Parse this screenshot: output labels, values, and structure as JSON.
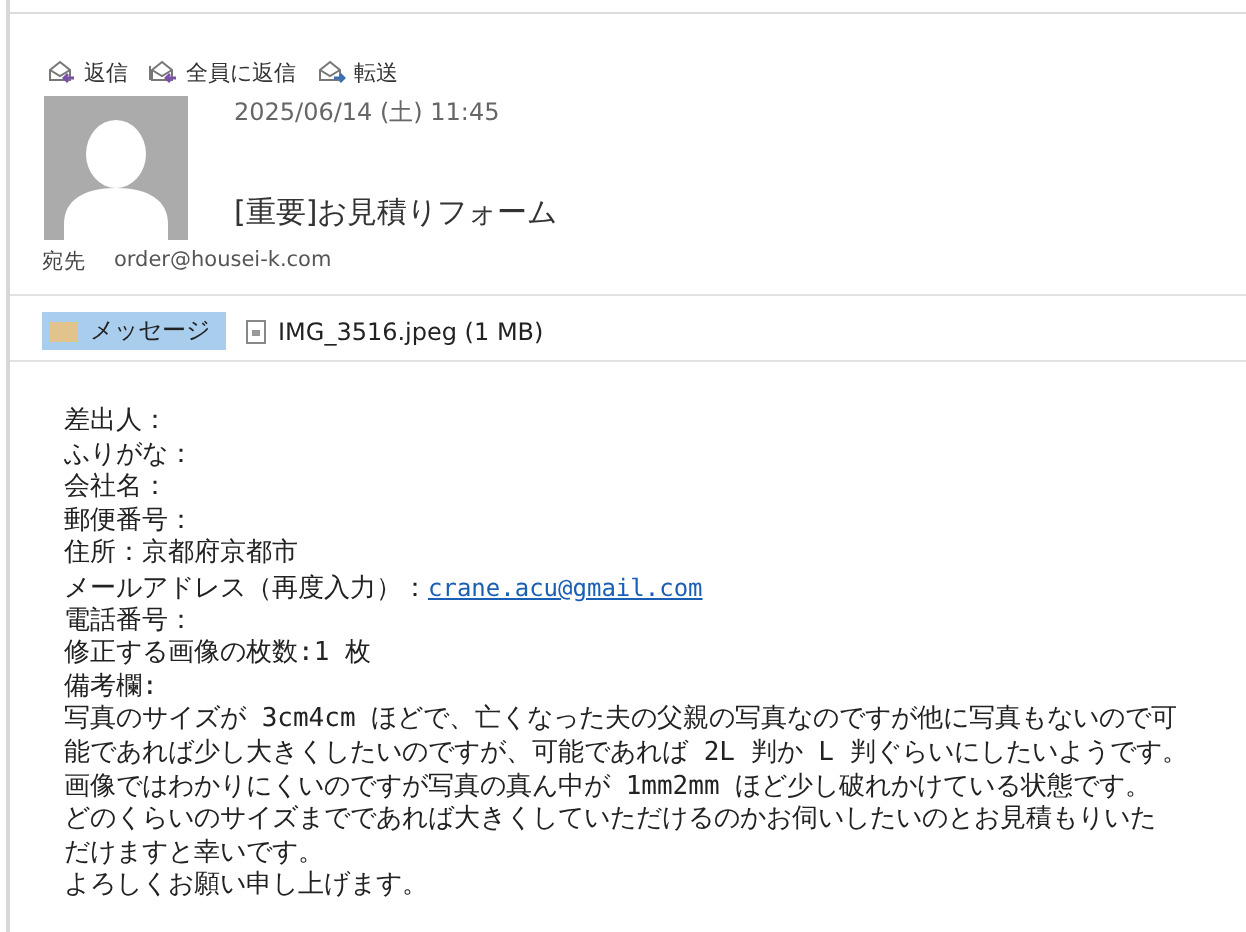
{
  "actions": [
    {
      "label": "返信",
      "kind": "reply"
    },
    {
      "label": "全員に返信",
      "kind": "reply_all"
    },
    {
      "label": "転送",
      "kind": "forward"
    }
  ],
  "date": "2025/06/14 (土) 11:45",
  "subject": "[重要]お見積りフォーム",
  "to": {
    "label": "宛先",
    "address": "order@housei-k.com"
  },
  "attachments": [
    {
      "label": "メッセージ",
      "kind": "message",
      "selected": true
    },
    {
      "label": "IMG_3516.jpeg (1 MB)",
      "kind": "file",
      "selected": false
    }
  ],
  "body": [
    {
      "text": "差出人："
    },
    {
      "text": "ふりがな："
    },
    {
      "text": "会社名："
    },
    {
      "text": "郵便番号："
    },
    {
      "text": "住所：京都府京都市"
    },
    {
      "text": "メールアドレス（再度入力）：",
      "link": "crane.acu@gmail.com"
    },
    {
      "text": "電話番号："
    },
    {
      "text": "修正する画像の枚数:1 枚"
    },
    {
      "text": "備考欄:"
    },
    {
      "text": "写真のサイズが 3cm4cm ほどで、亡くなった夫の父親の写真なのですが他に写真もないので可"
    },
    {
      "text": "能であれば少し大きくしたいのですが、可能であれば 2L 判か L 判ぐらいにしたいようです。"
    },
    {
      "text": "画像ではわかりにくいのですが写真の真ん中が 1mm2mm ほど少し破れかけている状態です。"
    },
    {
      "text": "どのくらいのサイズまでであれば大きくしていただけるのかお伺いしたいのとお見積もりいた"
    },
    {
      "text": "だけますと幸いです。"
    },
    {
      "text": "よろしくお願い申し上げます。"
    }
  ]
}
